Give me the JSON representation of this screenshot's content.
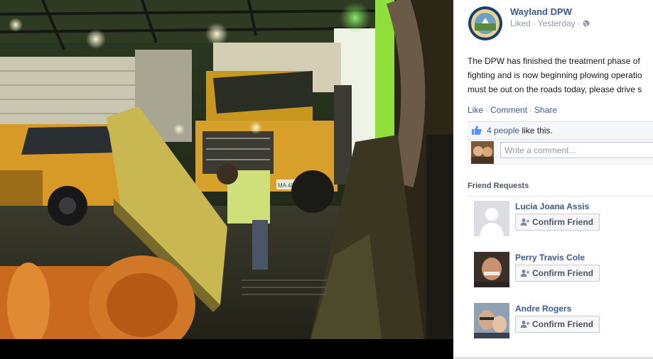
{
  "photo": {
    "alt_subject": "plow-truck-garage-photo",
    "plate_text": "MA 487"
  },
  "post": {
    "page_name": "Wayland DPW",
    "liked_label": "Liked",
    "timestamp": "Yesterday",
    "body_lines": [
      "The DPW has finished the treatment phase of",
      "fighting and is now beginning plowing operatio",
      "must be out on the roads today, please drive s"
    ],
    "actions": {
      "like": "Like",
      "comment": "Comment",
      "share": "Share"
    },
    "likes": {
      "count_text": "4 people",
      "suffix": " like this."
    },
    "comment_placeholder": "Write a comment...",
    "icons": {
      "privacy": "globe-icon",
      "likes": "thumbs-up-icon",
      "friend_button": "add-friend-icon"
    }
  },
  "friend_requests": {
    "heading": "Friend Requests",
    "confirm_label": "Confirm Friend",
    "items": [
      {
        "name": "Lucia Joana Assis"
      },
      {
        "name": "Perry Travis Cole"
      },
      {
        "name": "Andre Rogers"
      }
    ]
  },
  "colors": {
    "link": "#3b5998",
    "meta": "#9197a3",
    "heading": "#4e5665"
  }
}
